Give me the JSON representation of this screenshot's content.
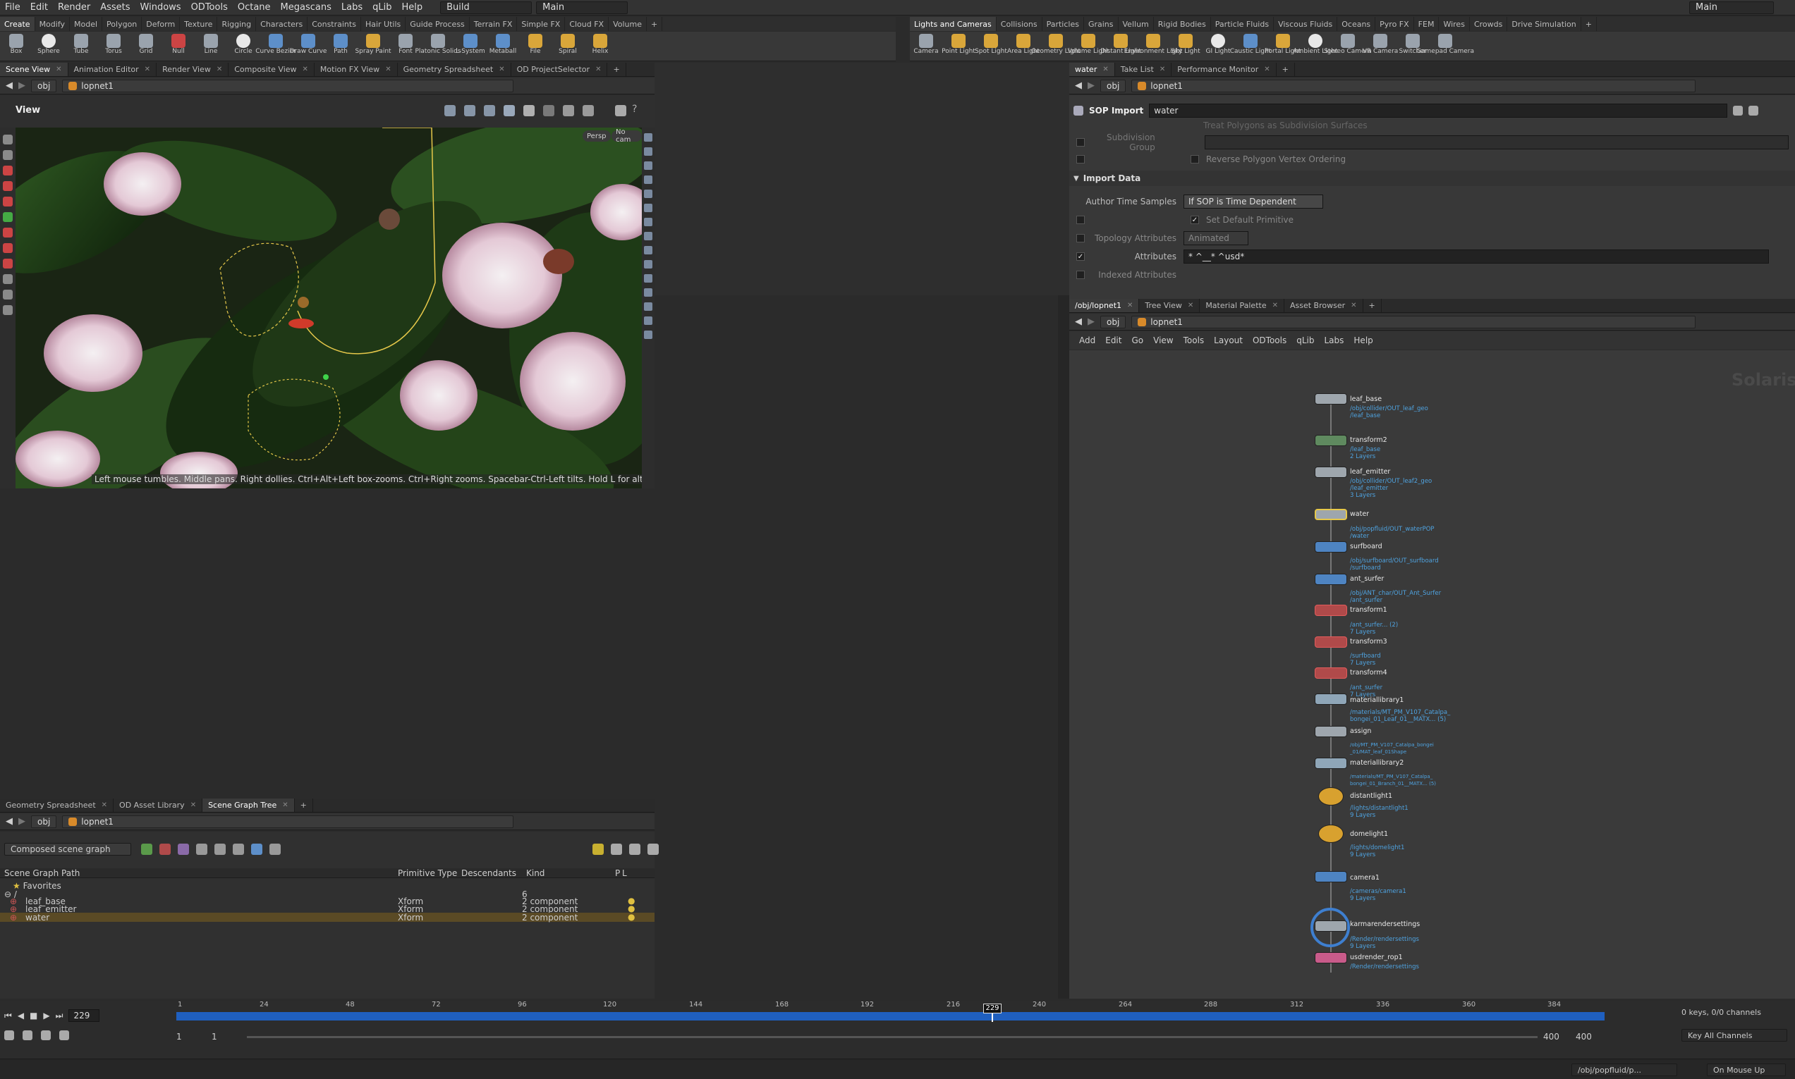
{
  "menu": [
    "File",
    "Edit",
    "Render",
    "Assets",
    "Windows",
    "ODTools",
    "Octane",
    "Megascans",
    "Labs",
    "qLib",
    "Help"
  ],
  "desktop": {
    "build": "Build",
    "main": "Main",
    "main_right": "Main"
  },
  "shelf_left": {
    "tabs": [
      "Create",
      "Modify",
      "Model",
      "Polygon",
      "Deform",
      "Texture",
      "Rigging",
      "Characters",
      "Constraints",
      "Hair Utils",
      "Guide Process",
      "Terrain FX",
      "Simple FX",
      "Cloud FX",
      "Volume"
    ],
    "tools": [
      "Box",
      "Sphere",
      "Tube",
      "Torus",
      "Grid",
      "Null",
      "Line",
      "Circle",
      "Curve Bezier",
      "Draw Curve",
      "Path",
      "Spray Paint",
      "Font",
      "Platonic Solids",
      "L-System",
      "Metaball",
      "File",
      "Spiral",
      "Helix"
    ]
  },
  "shelf_right": {
    "tabs": [
      "Lights and Cameras",
      "Collisions",
      "Particles",
      "Grains",
      "Vellum",
      "Rigid Bodies",
      "Particle Fluids",
      "Viscous Fluids",
      "Oceans",
      "Pyro FX",
      "FEM",
      "Wires",
      "Crowds",
      "Drive Simulation"
    ],
    "tools": [
      "Camera",
      "Point Light",
      "Spot Light",
      "Area Light",
      "Geometry Light",
      "Volume Light",
      "Distant Light",
      "Environment Light",
      "Sky Light",
      "GI Light",
      "Caustic Light",
      "Portal Light",
      "Ambient Light",
      "Stereo Camera",
      "VR Camera",
      "Switcher",
      "Gamepad Camera"
    ]
  },
  "left_tabs": [
    "Scene View",
    "Animation Editor",
    "Render View",
    "Composite View",
    "Motion FX View",
    "Geometry Spreadsheet",
    "OD ProjectSelector"
  ],
  "path_left": {
    "obj": "obj",
    "node": "lopnet1"
  },
  "viewport": {
    "title": "View",
    "persp": "Persp",
    "cam": "No cam",
    "hint": "Left mouse tumbles. Middle pans. Right dollies. Ctrl+Alt+Left box-zooms. Ctrl+Right zooms. Spacebar-Ctrl-Left tilts. Hold L for alternate tumble, dolly, and zoom.     M or Alt+M for First Person Navigation."
  },
  "param_tabs": [
    "water",
    "Take List",
    "Performance Monitor"
  ],
  "params": {
    "node_type": "SOP Import",
    "node_name": "water",
    "cut_text": "Treat Polygons as Subdivision Surfaces",
    "subdiv_group": "Subdivision Group",
    "reverse": "Reverse Polygon Vertex Ordering",
    "section": "Import Data",
    "author_label": "Author Time Samples",
    "author_value": "If SOP is Time Dependent",
    "set_default": "Set Default Primitive",
    "topo_label": "Topology Attributes",
    "topo_value": "Animated",
    "attrs_label": "Attributes",
    "attrs_value": "* ^__* ^usd*",
    "indexed_label": "Indexed Attributes"
  },
  "net_tabs": [
    "/obj/lopnet1",
    "Tree View",
    "Material Palette",
    "Asset Browser"
  ],
  "net_menu": [
    "Add",
    "Edit",
    "Go",
    "View",
    "Tools",
    "Layout",
    "ODTools",
    "qLib",
    "Labs",
    "Help"
  ],
  "net_watermark": "Solaris",
  "nodes": [
    {
      "name": "leaf_base",
      "sub": "/obj/collider/OUT_leaf_geo\n/leaf_base"
    },
    {
      "name": "transform2",
      "sub": "/leaf_base\n2 Layers"
    },
    {
      "name": "leaf_emitter",
      "sub": "/obj/collider/OUT_leaf2_geo\n/leaf_emitter\n3 Layers"
    },
    {
      "name": "water",
      "sub": "/obj/popfluid/OUT_waterPOP\n/water"
    },
    {
      "name": "surfboard",
      "sub": "/obj/surfboard/OUT_surfboard\n/surfboard"
    },
    {
      "name": "ant_surfer",
      "sub": "/obj/ANT_char/OUT_Ant_Surfer\n/ant_surfer"
    },
    {
      "name": "transform1",
      "sub": "/ant_surfer... (2)\n7 Layers"
    },
    {
      "name": "transform3",
      "sub": "/surfboard\n7 Layers"
    },
    {
      "name": "transform4",
      "sub": "/ant_surfer\n7 Layers"
    },
    {
      "name": "materiallibrary1",
      "sub": "/materials/MT_PM_V107_Catalpa_\nbongei_01_Leaf_01__MATX... (5)"
    },
    {
      "name": "assign",
      "sub": "/obj/MT_PM_V107_Catalpa_bongei\n_01/MAT_leaf_01Shape"
    },
    {
      "name": "materiallibrary2",
      "sub": "/materials/MT_PM_V107_Catalpa_\nbongei_01_Branch_01__MATX... (5)"
    },
    {
      "name": "distantlight1",
      "sub": "/lights/distantlight1\n9 Layers"
    },
    {
      "name": "domelight1",
      "sub": "/lights/domelight1\n9 Layers"
    },
    {
      "name": "camera1",
      "sub": "/cameras/camera1\n9 Layers"
    },
    {
      "name": "karmarendersettings",
      "sub": "/Render/rendersettings\n9 Layers"
    },
    {
      "name": "usdrender_rop1",
      "sub": "/Render/rendersettings"
    }
  ],
  "bottom_tabs": [
    "Geometry Spreadsheet",
    "OD Asset Library",
    "Scene Graph Tree"
  ],
  "scene_graph": {
    "mode": "Composed scene graph",
    "headers": [
      "Scene Graph Path",
      "Primitive Type",
      "Descendants",
      "Kind",
      "P",
      "L"
    ],
    "favorites": "Favorites",
    "root": "/",
    "root_count": "6",
    "rows": [
      {
        "path": "leaf_base",
        "type": "Xform",
        "kind": "2 component"
      },
      {
        "path": "leaf_emitter",
        "type": "Xform",
        "kind": "2 component"
      },
      {
        "path": "water",
        "type": "Xform",
        "kind": "2 component"
      }
    ]
  },
  "timeline": {
    "frame": "229",
    "ticks": [
      "1",
      "24",
      "48",
      "72",
      "96",
      "120",
      "144",
      "168",
      "192",
      "216",
      "240",
      "264",
      "288",
      "312",
      "336",
      "360",
      "384"
    ],
    "current": "229",
    "start": "1",
    "start2": "1",
    "end": "400",
    "end2": "400",
    "keys": "0 keys, 0/0 channels",
    "key_all": "Key All Channels",
    "status_path": "/obj/popfluid/p...",
    "on_mouse": "On Mouse Up"
  },
  "colors": {
    "accent_blue": "#2e6bd6",
    "timeline_bar": "#1f5fbf",
    "selected_row": "#5a4a25",
    "node_sel": "#e6c84a"
  }
}
